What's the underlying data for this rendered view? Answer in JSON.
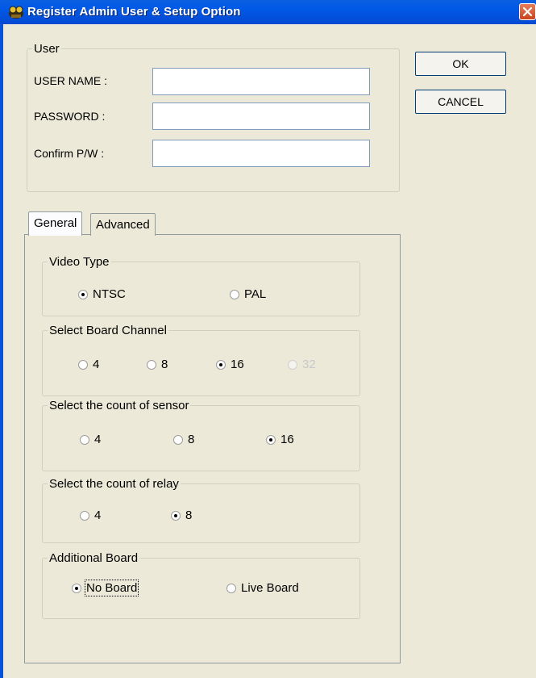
{
  "window": {
    "title": "Register Admin User &  Setup Option"
  },
  "user_group": {
    "legend": "User",
    "fields": [
      {
        "label": "USER NAME :",
        "value": ""
      },
      {
        "label": "PASSWORD :",
        "value": ""
      },
      {
        "label": "Confirm P/W  :",
        "value": ""
      }
    ]
  },
  "buttons": {
    "ok": "OK",
    "cancel": "CANCEL"
  },
  "tabs": [
    {
      "label": "General",
      "active": true
    },
    {
      "label": "Advanced",
      "active": false
    }
  ],
  "groups": {
    "video_type": {
      "legend": "Video Type",
      "options": [
        "NTSC",
        "PAL"
      ],
      "selected": "NTSC"
    },
    "board_channel": {
      "legend": "Select Board Channel",
      "options": [
        "4",
        "8",
        "16",
        "32"
      ],
      "selected": "16",
      "disabled": [
        "32"
      ]
    },
    "sensor_count": {
      "legend": "Select  the count of sensor",
      "options": [
        "4",
        "8",
        "16"
      ],
      "selected": "16"
    },
    "relay_count": {
      "legend": "Select  the count of relay",
      "options": [
        "4",
        "8"
      ],
      "selected": "8"
    },
    "additional_board": {
      "legend": "Additional Board",
      "options": [
        "No Board",
        "Live Board"
      ],
      "selected": "No Board"
    }
  }
}
